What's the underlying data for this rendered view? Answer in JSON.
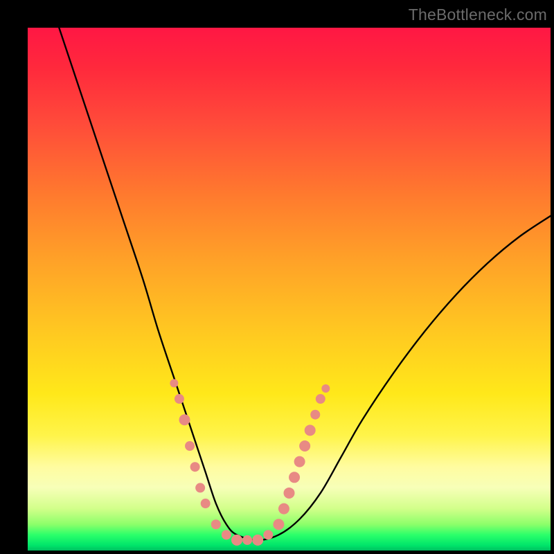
{
  "watermark": {
    "text": "TheBottleneck.com"
  },
  "chart_data": {
    "type": "line",
    "title": "",
    "xlabel": "",
    "ylabel": "",
    "xlim": [
      0,
      100
    ],
    "ylim": [
      0,
      100
    ],
    "series": [
      {
        "name": "bottleneck-curve",
        "x": [
          6,
          10,
          14,
          18,
          22,
          25,
          28,
          30,
          32,
          34,
          36,
          38,
          40,
          44,
          48,
          52,
          56,
          60,
          64,
          70,
          76,
          82,
          88,
          94,
          100
        ],
        "y": [
          100,
          88,
          76,
          64,
          52,
          42,
          33,
          27,
          21,
          15,
          9,
          5,
          3,
          2,
          3,
          6,
          11,
          18,
          25,
          34,
          42,
          49,
          55,
          60,
          64
        ]
      }
    ],
    "markers": {
      "name": "benchmark-points",
      "color": "#e88a84",
      "points": [
        {
          "x": 28,
          "y": 32,
          "r": 6
        },
        {
          "x": 29,
          "y": 29,
          "r": 7
        },
        {
          "x": 30,
          "y": 25,
          "r": 8
        },
        {
          "x": 31,
          "y": 20,
          "r": 7
        },
        {
          "x": 32,
          "y": 16,
          "r": 7
        },
        {
          "x": 33,
          "y": 12,
          "r": 7
        },
        {
          "x": 34,
          "y": 9,
          "r": 7
        },
        {
          "x": 36,
          "y": 5,
          "r": 7
        },
        {
          "x": 38,
          "y": 3,
          "r": 7
        },
        {
          "x": 40,
          "y": 2,
          "r": 8
        },
        {
          "x": 42,
          "y": 2,
          "r": 7
        },
        {
          "x": 44,
          "y": 2,
          "r": 8
        },
        {
          "x": 46,
          "y": 3,
          "r": 7
        },
        {
          "x": 48,
          "y": 5,
          "r": 8
        },
        {
          "x": 49,
          "y": 8,
          "r": 8
        },
        {
          "x": 50,
          "y": 11,
          "r": 8
        },
        {
          "x": 51,
          "y": 14,
          "r": 8
        },
        {
          "x": 52,
          "y": 17,
          "r": 8
        },
        {
          "x": 53,
          "y": 20,
          "r": 8
        },
        {
          "x": 54,
          "y": 23,
          "r": 8
        },
        {
          "x": 55,
          "y": 26,
          "r": 7
        },
        {
          "x": 56,
          "y": 29,
          "r": 7
        },
        {
          "x": 57,
          "y": 31,
          "r": 6
        }
      ]
    },
    "background_gradient": {
      "top": "#ff1744",
      "mid": "#ffe81a",
      "bottom": "#00c060"
    }
  }
}
